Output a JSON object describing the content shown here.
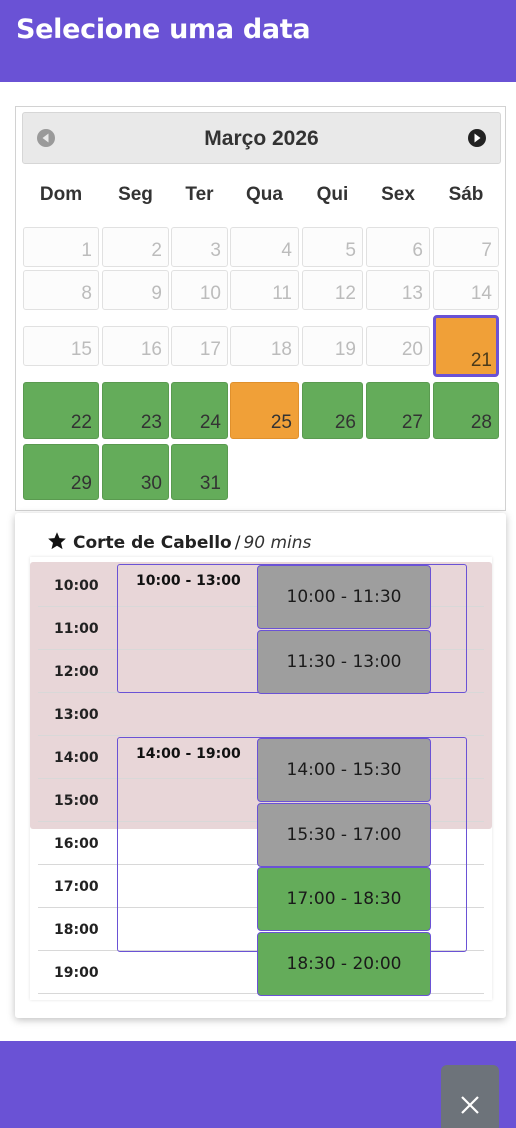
{
  "header": {
    "title": "Selecione uma data"
  },
  "calendar": {
    "month_title": "Março 2026",
    "prev_label": "prev-month-icon",
    "next_label": "next-month-icon",
    "weekdays": [
      "Dom",
      "Seg",
      "Ter",
      "Qua",
      "Qui",
      "Sex",
      "Sáb"
    ],
    "days": [
      {
        "n": "1",
        "state": "disabled"
      },
      {
        "n": "2",
        "state": "disabled"
      },
      {
        "n": "3",
        "state": "disabled"
      },
      {
        "n": "4",
        "state": "disabled"
      },
      {
        "n": "5",
        "state": "disabled"
      },
      {
        "n": "6",
        "state": "disabled"
      },
      {
        "n": "7",
        "state": "disabled"
      },
      {
        "n": "8",
        "state": "disabled"
      },
      {
        "n": "9",
        "state": "disabled"
      },
      {
        "n": "10",
        "state": "disabled"
      },
      {
        "n": "11",
        "state": "disabled"
      },
      {
        "n": "12",
        "state": "disabled"
      },
      {
        "n": "13",
        "state": "disabled"
      },
      {
        "n": "14",
        "state": "disabled"
      },
      {
        "n": "15",
        "state": "disabled"
      },
      {
        "n": "16",
        "state": "disabled"
      },
      {
        "n": "17",
        "state": "disabled"
      },
      {
        "n": "18",
        "state": "disabled"
      },
      {
        "n": "19",
        "state": "disabled"
      },
      {
        "n": "20",
        "state": "disabled"
      },
      {
        "n": "21",
        "state": "selected"
      },
      {
        "n": "22",
        "state": "available"
      },
      {
        "n": "23",
        "state": "available"
      },
      {
        "n": "24",
        "state": "available"
      },
      {
        "n": "25",
        "state": "partial"
      },
      {
        "n": "26",
        "state": "available"
      },
      {
        "n": "27",
        "state": "available"
      },
      {
        "n": "28",
        "state": "available"
      },
      {
        "n": "29",
        "state": "available"
      },
      {
        "n": "30",
        "state": "available"
      },
      {
        "n": "31",
        "state": "available"
      }
    ]
  },
  "service": {
    "icon": "star-icon",
    "name": "Corte de Cabello",
    "separator": "/",
    "duration": "90 mins",
    "hours": [
      "10:00",
      "11:00",
      "12:00",
      "13:00",
      "14:00",
      "15:00",
      "16:00",
      "17:00",
      "18:00",
      "19:00"
    ],
    "blocks": [
      {
        "label": "10:00 - 13:00"
      },
      {
        "label": "14:00 - 19:00"
      }
    ],
    "slots": [
      {
        "label": "10:00 - 11:30",
        "status": "taken"
      },
      {
        "label": "11:30 - 13:00",
        "status": "taken"
      },
      {
        "label": "14:00 - 15:30",
        "status": "taken"
      },
      {
        "label": "15:30 - 17:00",
        "status": "taken"
      },
      {
        "label": "17:00 - 18:30",
        "status": "free"
      },
      {
        "label": "18:30 - 20:00",
        "status": "free"
      }
    ]
  },
  "footer": {
    "close_icon": "close-icon"
  },
  "colors": {
    "brand": "#6a52d5",
    "available": "#64ac5a",
    "partial": "#f0a038",
    "taken": "#9e9e9e",
    "busy_background": "#e8d6d8"
  }
}
